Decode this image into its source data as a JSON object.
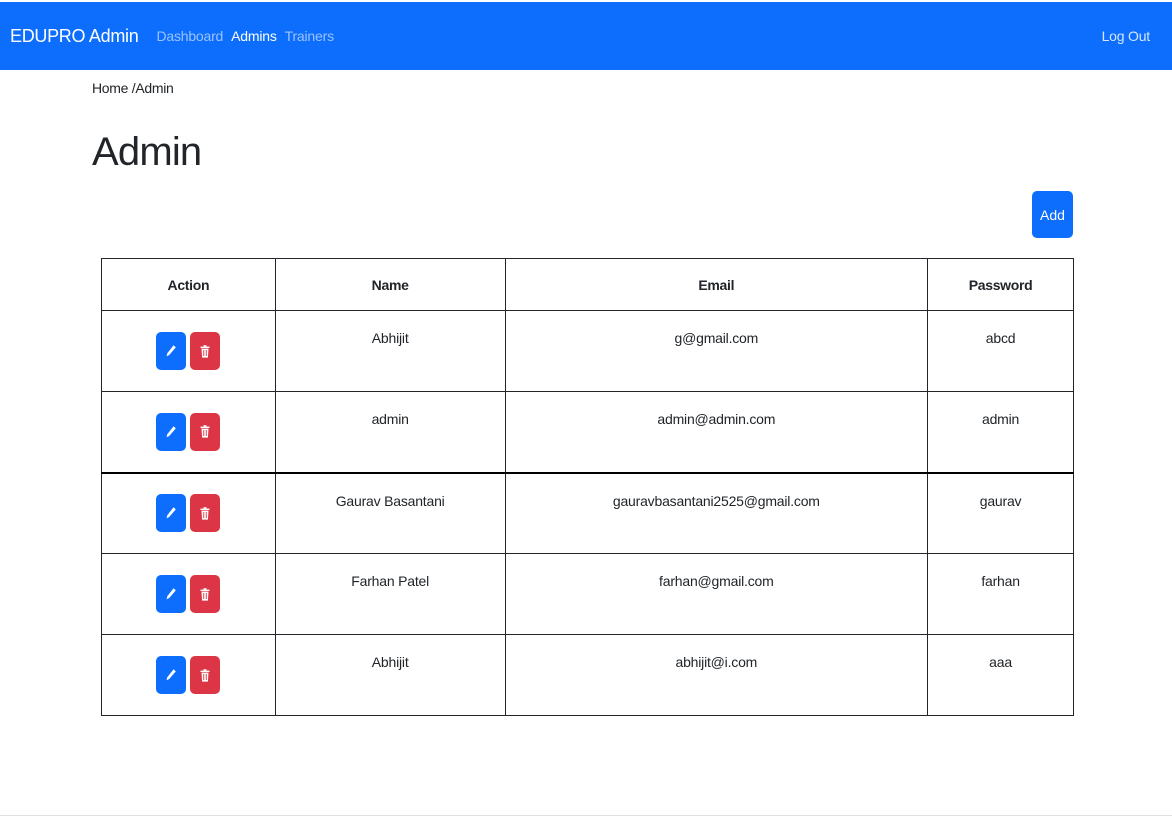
{
  "navbar": {
    "brand": "EDUPRO Admin",
    "links": [
      {
        "label": "Dashboard",
        "active": false
      },
      {
        "label": "Admins",
        "active": true
      },
      {
        "label": "Trainers",
        "active": false
      }
    ],
    "logout_label": "Log Out"
  },
  "breadcrumb": "Home /Admin",
  "page_title": "Admin",
  "add_button_label": "Add",
  "table": {
    "headers": [
      "Action",
      "Name",
      "Email",
      "Password"
    ],
    "rows": [
      {
        "name": "Abhijit",
        "email": "g@gmail.com",
        "password": "abcd"
      },
      {
        "name": "admin",
        "email": "admin@admin.com",
        "password": "admin"
      },
      {
        "name": "Gaurav Basantani",
        "email": "gauravbasantani2525@gmail.com",
        "password": "gaurav"
      },
      {
        "name": "Farhan Patel",
        "email": "farhan@gmail.com",
        "password": "farhan"
      },
      {
        "name": "Abhijit",
        "email": "abhijit@i.com",
        "password": "aaa"
      }
    ],
    "row_actions": {
      "edit_icon": "pencil-icon",
      "delete_icon": "trash-icon"
    }
  },
  "colors": {
    "primary": "#0d6efd",
    "danger": "#dc3545",
    "text": "#212529"
  }
}
